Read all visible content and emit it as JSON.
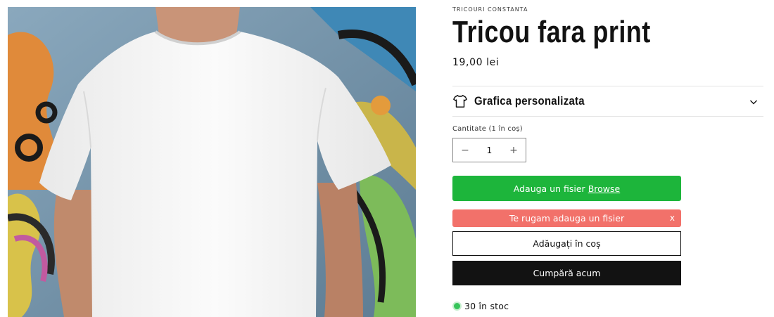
{
  "product": {
    "vendor": "TRICOURI CONSTANTA",
    "title": "Tricou fara print",
    "price": "19,00 lei"
  },
  "accordion": {
    "label": "Grafica personalizata",
    "icon": "tshirt-icon",
    "toggle_icon": "chevron-down-icon"
  },
  "quantity": {
    "label": "Cantitate (1 în coș)",
    "value": "1",
    "decrease": "−",
    "increase": "+"
  },
  "upload": {
    "text": "Adauga un fisier",
    "link": "Browse",
    "color": "#1db53b"
  },
  "error": {
    "text": "Te rugam adauga un fisier",
    "close": "x",
    "color": "#f2716a"
  },
  "buttons": {
    "add_to_cart": "Adăugați în coș",
    "buy_now": "Cumpără acum"
  },
  "stock": {
    "text": "30 în stoc",
    "color": "#36c45a"
  }
}
